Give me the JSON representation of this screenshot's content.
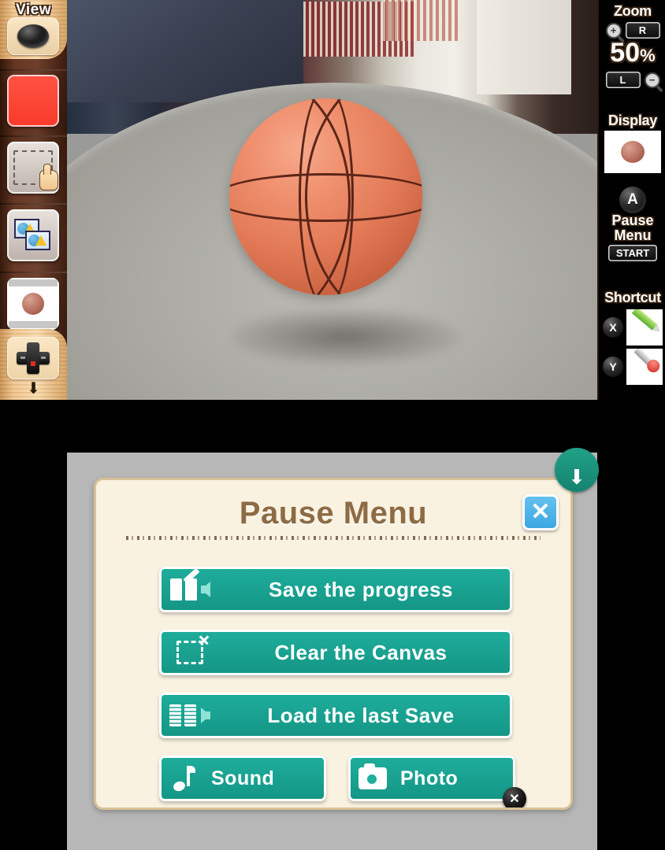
{
  "top_screen": {
    "left_toolbar": {
      "view_label": "View",
      "view_button_icon": "camera-lens-icon",
      "tools": [
        {
          "name": "color-swatch",
          "icon": "color-swatch-icon",
          "color": "#fb3f2e"
        },
        {
          "name": "selection-tool",
          "icon": "selection-hand-icon"
        },
        {
          "name": "layers-tool",
          "icon": "layers-icon"
        },
        {
          "name": "reference-photo",
          "icon": "reference-photo-icon"
        }
      ],
      "dpad_icon": "dpad-icon",
      "scroll_hint_icon": "down-arrow-icon"
    },
    "camera_view": {
      "subject": "basketball on a round table",
      "alt": "Live camera reference view showing an orange basketball resting on a grey round table in a room"
    },
    "right_toolbar": {
      "zoom": {
        "title": "Zoom",
        "zoom_in_icon": "magnifier-plus-icon",
        "zoom_in_button": "R",
        "value": "50",
        "value_unit": "%",
        "zoom_out_button": "L",
        "zoom_out_icon": "magnifier-minus-icon"
      },
      "display": {
        "title": "Display",
        "thumbnail_icon": "reference-photo-icon",
        "toggle_button": "A"
      },
      "pause": {
        "line1": "Pause",
        "line2": "Menu",
        "button": "START"
      },
      "shortcut": {
        "title": "Shortcut",
        "items": [
          {
            "button": "X",
            "icon": "pencil-icon",
            "color": "#58b02c"
          },
          {
            "button": "Y",
            "icon": "eyedropper-icon",
            "color": "#c4241c"
          }
        ]
      }
    }
  },
  "bottom_screen": {
    "pull_tab_icon": "down-arrow-icon",
    "dialog": {
      "title": "Pause Menu",
      "close_label": "✕",
      "close_icon": "close-icon",
      "buttons": [
        {
          "label": "Save the progress",
          "icon": "book-pencil-icon"
        },
        {
          "label": "Clear the Canvas",
          "icon": "dashed-selection-sparkle-icon"
        },
        {
          "label": "Load the last Save",
          "icon": "open-book-arrow-icon"
        },
        {
          "label": "Sound",
          "icon": "music-note-icon"
        },
        {
          "label": "Photo",
          "icon": "camera-icon"
        }
      ],
      "photo_badge": "✕",
      "photo_badge_icon": "x-button-icon"
    }
  },
  "colors": {
    "teal_button": "#1fae9c",
    "title_brown": "#8d6b44",
    "panel_cream": "#faf2e1",
    "close_blue": "#3aa5e0",
    "screen_frame_grey": "#b7b7b7",
    "wood_tan": "#f6ddb4",
    "toolbar_wood": "#50220f",
    "swatch_red": "#fb3f2e"
  }
}
